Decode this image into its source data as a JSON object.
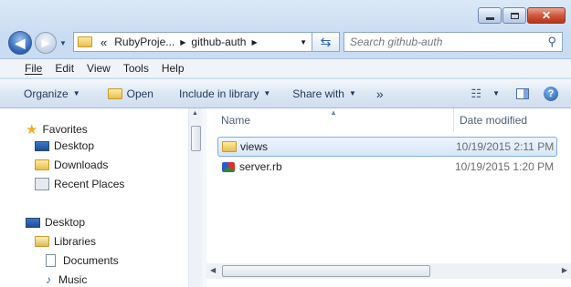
{
  "address": {
    "overflow": "«",
    "crumbs": [
      "RubyProje...",
      "github-auth"
    ]
  },
  "search": {
    "placeholder": "Search github-auth"
  },
  "menu": [
    "File",
    "Edit",
    "View",
    "Tools",
    "Help"
  ],
  "commands": {
    "organize": "Organize",
    "open": "Open",
    "include": "Include in library",
    "share": "Share with",
    "more": "»"
  },
  "nav": {
    "favorites": "Favorites",
    "desktop": "Desktop",
    "downloads": "Downloads",
    "recent": "Recent Places",
    "desktop_root": "Desktop",
    "libraries": "Libraries",
    "documents": "Documents",
    "music": "Music"
  },
  "columns": {
    "name": "Name",
    "date": "Date modified"
  },
  "files": [
    {
      "name": "views",
      "date": "10/19/2015 2:11 PM",
      "icon": "folder-icon"
    },
    {
      "name": "server.rb",
      "date": "10/19/2015 1:20 PM",
      "icon": "ruby-file-icon"
    }
  ],
  "colors": {
    "selection": "#d6e7fb",
    "accent": "#1e395b"
  }
}
